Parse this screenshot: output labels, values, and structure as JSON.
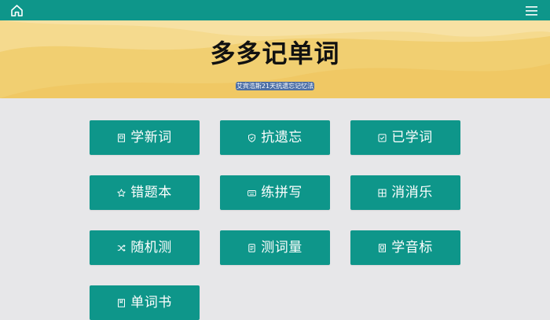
{
  "topbar": {
    "home_icon": "home-icon",
    "menu_icon": "hamburger-menu-icon",
    "color": "#0e968a"
  },
  "hero": {
    "title": "多多记单词",
    "subtitle": "艾宾浩斯21天抗遗忘记忆法",
    "background": "#f1cf71",
    "subtitle_bg": "#4d6fa6"
  },
  "tiles": [
    {
      "label": "学新词",
      "icon": "book-icon"
    },
    {
      "label": "抗遗忘",
      "icon": "shield-icon"
    },
    {
      "label": "已学词",
      "icon": "checkbox-icon"
    },
    {
      "label": "错题本",
      "icon": "star-icon"
    },
    {
      "label": "练拼写",
      "icon": "keyboard-icon"
    },
    {
      "label": "消消乐",
      "icon": "grid-icon"
    },
    {
      "label": "随机测",
      "icon": "shuffle-icon"
    },
    {
      "label": "测词量",
      "icon": "clipboard-icon"
    },
    {
      "label": "学音标",
      "icon": "phonetic-book-icon"
    },
    {
      "label": "单词书",
      "icon": "bookmark-book-icon"
    }
  ],
  "accent": "#0e968a"
}
